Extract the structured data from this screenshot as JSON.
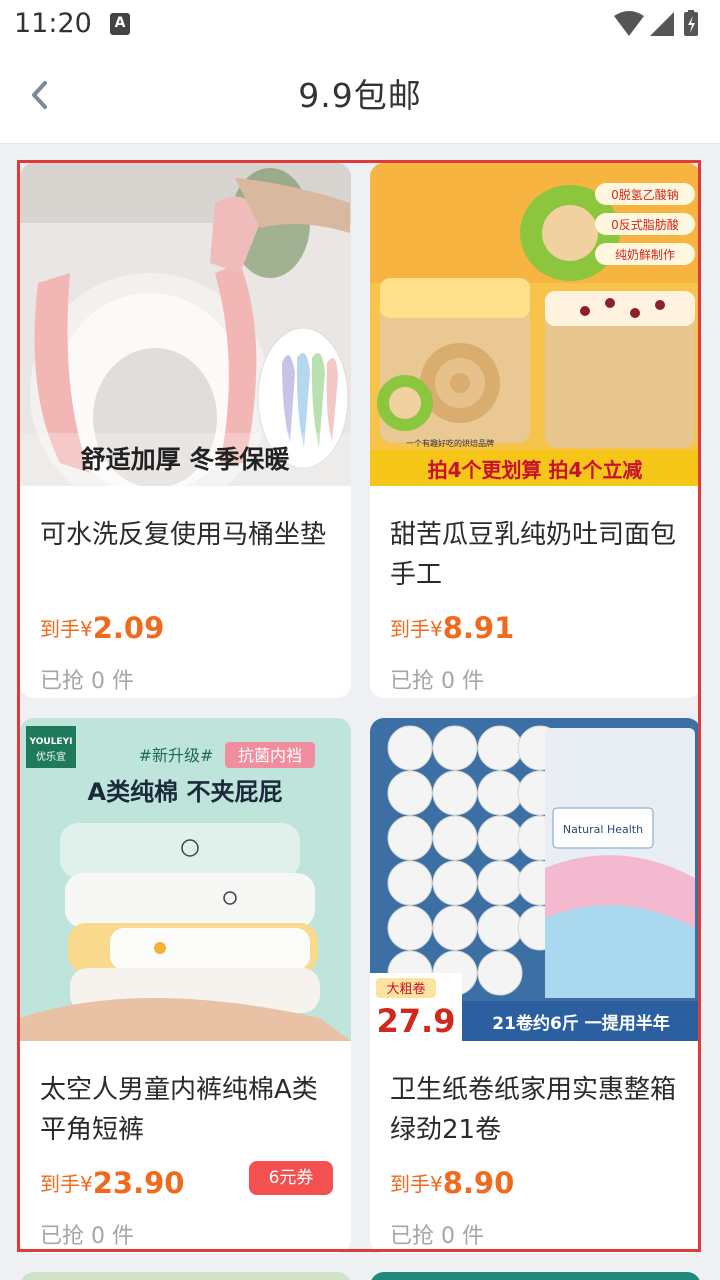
{
  "status_bar": {
    "time": "11:20",
    "notification_badge": "A"
  },
  "nav": {
    "title": "9.9包邮"
  },
  "products": [
    {
      "name": "可水洗反复使用马桶坐垫",
      "price_prefix": "到手¥",
      "price": "2.09",
      "sold": "已抢 0 件",
      "image_caption": "舒适加厚 冬季保暖"
    },
    {
      "name": "甜苦瓜豆乳纯奶吐司面包手工",
      "price_prefix": "到手¥",
      "price": "8.91",
      "sold": "已抢 0 件",
      "image_banner": "拍4个更划算 拍4个立减",
      "image_tags": [
        "0脱氢乙酸钠",
        "0反式脂肪酸",
        "纯奶鲜制作"
      ],
      "image_slogan": "一个有趣好吃的烘焙品牌"
    },
    {
      "name": "太空人男童内裤纯棉A类平角短裤",
      "price_prefix": "到手¥",
      "price": "23.90",
      "sold": "已抢 0 件",
      "coupon": "6元券",
      "image_brand": "YOULEYI",
      "image_brand_cn": "优乐宜",
      "image_tag1": "#新升级#",
      "image_tag2": "抗菌内裆",
      "image_headline": "A类纯棉  不夹屁屁"
    },
    {
      "name": "卫生纸卷纸家用实惠整箱绿劲21卷",
      "price_prefix": "到手¥",
      "price": "8.90",
      "sold": "已抢 0 件",
      "image_badge_top": "大粗卷",
      "image_badge_price": "27.9",
      "image_banner": "21卷约6斤  一提用半年",
      "image_pack_label": "Natural Health"
    }
  ],
  "colors": {
    "accent_price": "#f06a1e",
    "coupon_bg": "#f35050",
    "highlight_border": "#e03a3a",
    "page_bg": "#eef0f3"
  }
}
